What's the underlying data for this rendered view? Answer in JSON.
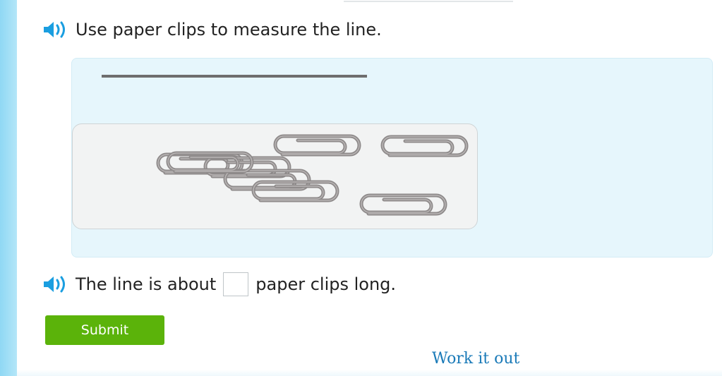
{
  "question": {
    "prompt": "Use paper clips to measure the line.",
    "answer_prefix": "The line is about",
    "answer_suffix": "paper clips long.",
    "answer_value": ""
  },
  "buttons": {
    "submit_label": "Submit"
  },
  "links": {
    "work_it_out": "Work it out"
  },
  "icons": {
    "speaker": "speaker-icon",
    "paper_clip": "paper-clip-icon"
  },
  "colors": {
    "submit": "#5bb30a",
    "link": "#1a7ab8",
    "speaker": "#1a9ee0",
    "clip": "#8e8a8a"
  },
  "paper_clip_count": 8
}
